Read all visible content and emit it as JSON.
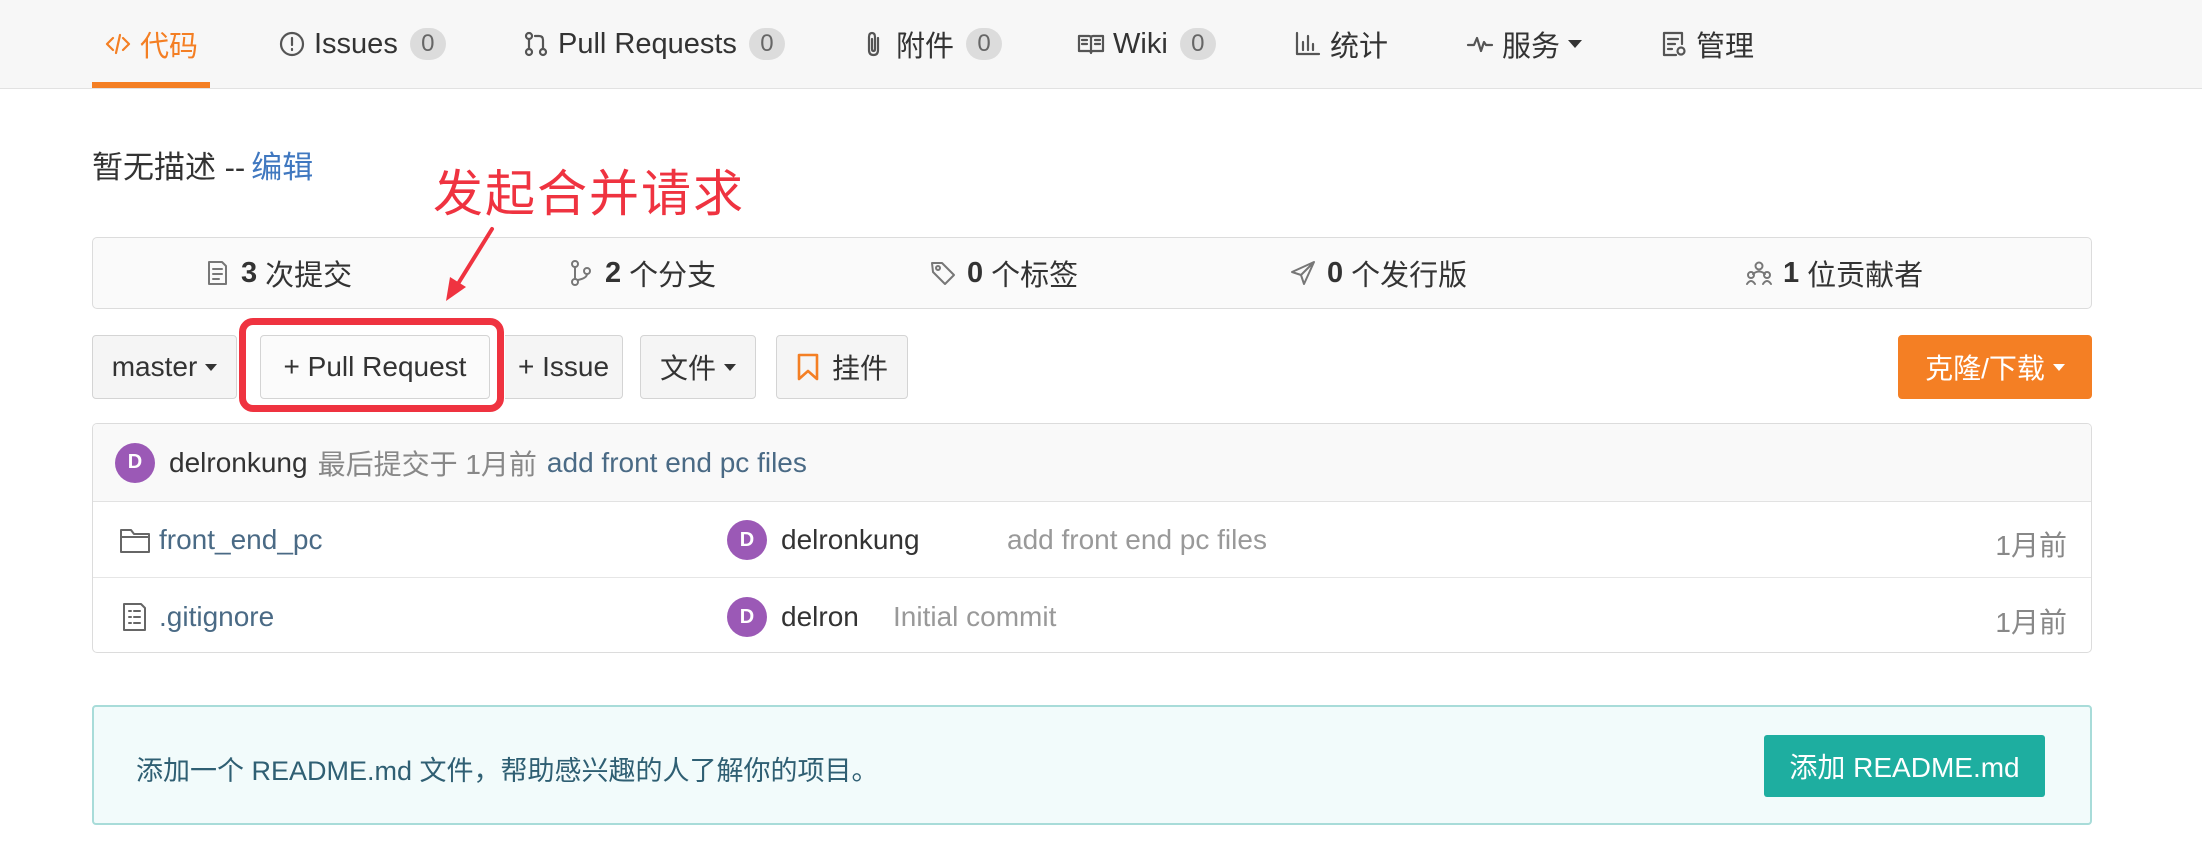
{
  "nav": {
    "tabs": [
      {
        "label": "代码",
        "active": true,
        "icon": "code-icon"
      },
      {
        "label": "Issues",
        "count": "0",
        "icon": "issue-icon"
      },
      {
        "label": "Pull Requests",
        "count": "0",
        "icon": "pull-request-icon"
      },
      {
        "label": "附件",
        "count": "0",
        "icon": "paperclip-icon"
      },
      {
        "label": "Wiki",
        "count": "0",
        "icon": "book-icon"
      },
      {
        "label": "统计",
        "icon": "bar-chart-icon"
      },
      {
        "label": "服务",
        "icon": "pulse-icon",
        "dropdown": true
      },
      {
        "label": "管理",
        "icon": "settings-doc-icon"
      }
    ]
  },
  "description": {
    "text": "暂无描述 --",
    "edit_link": "编辑"
  },
  "annotation": {
    "text": "发起合并请求",
    "color": "#ef3340"
  },
  "stats": [
    {
      "value": "3",
      "label": "次提交",
      "icon": "commit-icon"
    },
    {
      "value": "2",
      "label": "个分支",
      "icon": "branch-icon"
    },
    {
      "value": "0",
      "label": "个标签",
      "icon": "tag-icon"
    },
    {
      "value": "0",
      "label": "个发行版",
      "icon": "release-icon"
    },
    {
      "value": "1",
      "label": "位贡献者",
      "icon": "contributors-icon"
    }
  ],
  "toolbar": {
    "branch": "master",
    "pull_request": "+ Pull Request",
    "issue": "+ Issue",
    "files": "文件",
    "widget": "挂件",
    "clone": "克隆/下载"
  },
  "last_commit": {
    "avatar": "D",
    "author": "delronkung",
    "meta": "最后提交于 1月前",
    "message": "add front end pc files"
  },
  "files": [
    {
      "type": "folder",
      "name": "front_end_pc",
      "avatar": "D",
      "author": "delronkung",
      "message": "add front end pc files",
      "time": "1月前"
    },
    {
      "type": "file",
      "name": ".gitignore",
      "avatar": "D",
      "author": "delron",
      "message": "Initial commit",
      "time": "1月前"
    }
  ],
  "readme": {
    "text": "添加一个 README.md 文件，帮助感兴趣的人了解你的项目。",
    "button": "添加 README.md"
  },
  "colors": {
    "accent": "#f47f24",
    "teal": "#1eaea0",
    "avatar": "#9b59b6",
    "link": "#4a6a85"
  }
}
